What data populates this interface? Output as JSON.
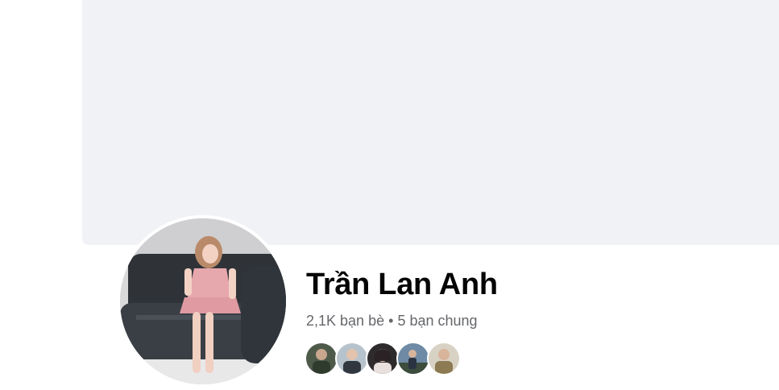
{
  "profile": {
    "name": "Trần Lan Anh",
    "friends_count": "2,1K bạn bè",
    "separator": "•",
    "mutual_count": "5 bạn chung"
  },
  "mutual_friends": [
    {
      "icon": "friend-avatar-1"
    },
    {
      "icon": "friend-avatar-2"
    },
    {
      "icon": "friend-avatar-3"
    },
    {
      "icon": "friend-avatar-4"
    },
    {
      "icon": "friend-avatar-5"
    }
  ],
  "colors": {
    "cover_bg": "#f0f2f5",
    "name_text": "#050505",
    "secondary_text": "#65676b"
  }
}
